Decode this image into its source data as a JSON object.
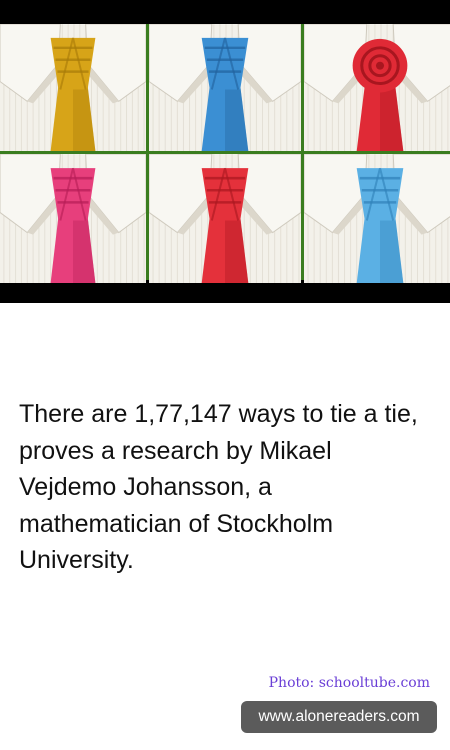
{
  "image_grid": {
    "alt": "",
    "ties": [
      {
        "icon": "gold-tie-knot",
        "color": "#d7a418",
        "shade": "#a77a08"
      },
      {
        "icon": "blue-tie-knot",
        "color": "#3b8fd3",
        "shade": "#21619c"
      },
      {
        "icon": "red-rose-tie-knot",
        "color": "#e02a36",
        "shade": "#a8161f"
      },
      {
        "icon": "pink-tie-knot",
        "color": "#e73f7c",
        "shade": "#b51c55"
      },
      {
        "icon": "red-tie-knot",
        "color": "#e4313b",
        "shade": "#a9171f"
      },
      {
        "icon": "light-blue-tie-knot",
        "color": "#5bb0e4",
        "shade": "#2f80b8"
      }
    ]
  },
  "article": {
    "fact_text": "There are 1,77,147 ways to tie a tie, proves a research by Mikael Vejdemo Johansson, a mathematician of Stockholm University.",
    "photo_credit": "Photo: schooltube.com",
    "source_label": "www.alonereaders.com"
  },
  "colors": {
    "text": "#111111",
    "credit": "#6a3fd6",
    "badge": "#5b5b5b",
    "grid_line": "#3a7d1f"
  }
}
